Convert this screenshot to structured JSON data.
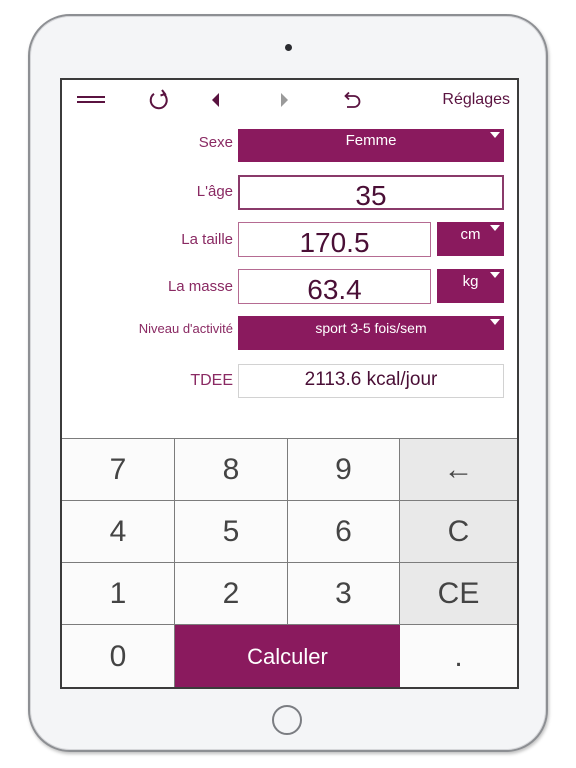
{
  "toolbar": {
    "menu_icon": "hamburger-icon",
    "refresh_icon": "refresh-icon",
    "back_icon": "triangle-left-icon",
    "forward_icon": "triangle-right-icon",
    "undo_icon": "undo-icon",
    "settings_label": "Réglages"
  },
  "form": {
    "sex": {
      "label": "Sexe",
      "value": "Femme"
    },
    "age": {
      "label": "L'âge",
      "value": "35"
    },
    "height": {
      "label": "La taille",
      "value": "170.5",
      "unit": "cm"
    },
    "mass": {
      "label": "La masse",
      "value": "63.4",
      "unit": "kg"
    },
    "activity": {
      "label": "Niveau d'activité",
      "value": "sport 3-5 fois/sem"
    },
    "tdee": {
      "label": "TDEE",
      "value": "2113.6 kcal/jour"
    }
  },
  "keypad": {
    "keys": [
      "7",
      "8",
      "9",
      "←",
      "4",
      "5",
      "6",
      "C",
      "1",
      "2",
      "3",
      "CE",
      "0",
      "Calculer",
      "."
    ]
  },
  "colors": {
    "accent": "#8a1a5e",
    "label": "#8a2a63",
    "value_text": "#4a0f36",
    "function_key_bg": "#e9e9e9"
  }
}
